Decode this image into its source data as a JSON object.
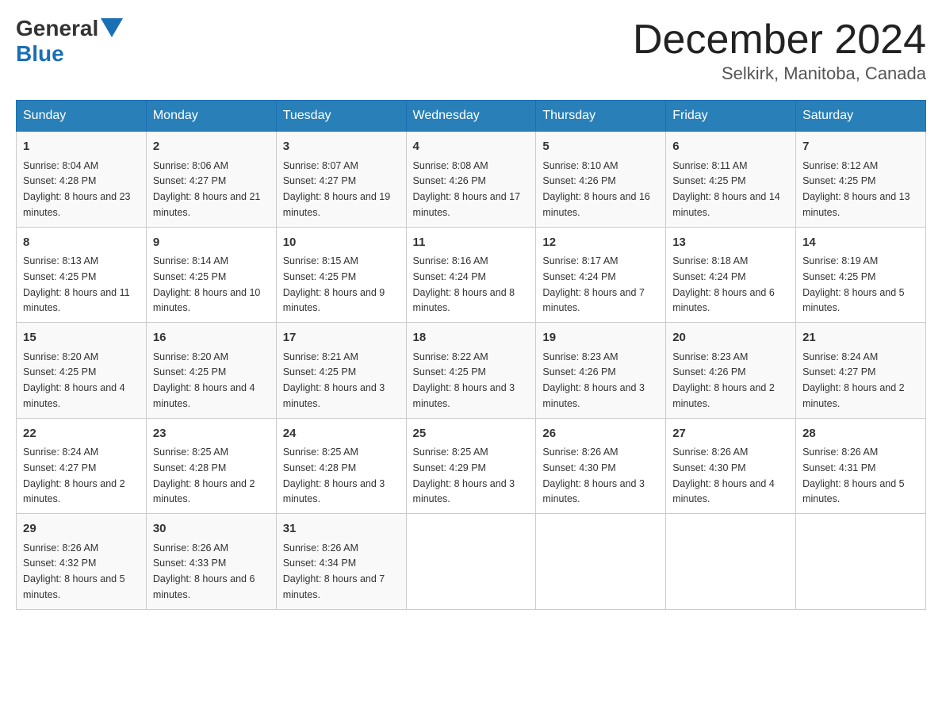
{
  "header": {
    "logo_general": "General",
    "logo_blue": "Blue",
    "month_title": "December 2024",
    "location": "Selkirk, Manitoba, Canada"
  },
  "days_of_week": [
    "Sunday",
    "Monday",
    "Tuesday",
    "Wednesday",
    "Thursday",
    "Friday",
    "Saturday"
  ],
  "weeks": [
    [
      {
        "day": "1",
        "sunrise": "8:04 AM",
        "sunset": "4:28 PM",
        "daylight": "8 hours and 23 minutes."
      },
      {
        "day": "2",
        "sunrise": "8:06 AM",
        "sunset": "4:27 PM",
        "daylight": "8 hours and 21 minutes."
      },
      {
        "day": "3",
        "sunrise": "8:07 AM",
        "sunset": "4:27 PM",
        "daylight": "8 hours and 19 minutes."
      },
      {
        "day": "4",
        "sunrise": "8:08 AM",
        "sunset": "4:26 PM",
        "daylight": "8 hours and 17 minutes."
      },
      {
        "day": "5",
        "sunrise": "8:10 AM",
        "sunset": "4:26 PM",
        "daylight": "8 hours and 16 minutes."
      },
      {
        "day": "6",
        "sunrise": "8:11 AM",
        "sunset": "4:25 PM",
        "daylight": "8 hours and 14 minutes."
      },
      {
        "day": "7",
        "sunrise": "8:12 AM",
        "sunset": "4:25 PM",
        "daylight": "8 hours and 13 minutes."
      }
    ],
    [
      {
        "day": "8",
        "sunrise": "8:13 AM",
        "sunset": "4:25 PM",
        "daylight": "8 hours and 11 minutes."
      },
      {
        "day": "9",
        "sunrise": "8:14 AM",
        "sunset": "4:25 PM",
        "daylight": "8 hours and 10 minutes."
      },
      {
        "day": "10",
        "sunrise": "8:15 AM",
        "sunset": "4:25 PM",
        "daylight": "8 hours and 9 minutes."
      },
      {
        "day": "11",
        "sunrise": "8:16 AM",
        "sunset": "4:24 PM",
        "daylight": "8 hours and 8 minutes."
      },
      {
        "day": "12",
        "sunrise": "8:17 AM",
        "sunset": "4:24 PM",
        "daylight": "8 hours and 7 minutes."
      },
      {
        "day": "13",
        "sunrise": "8:18 AM",
        "sunset": "4:24 PM",
        "daylight": "8 hours and 6 minutes."
      },
      {
        "day": "14",
        "sunrise": "8:19 AM",
        "sunset": "4:25 PM",
        "daylight": "8 hours and 5 minutes."
      }
    ],
    [
      {
        "day": "15",
        "sunrise": "8:20 AM",
        "sunset": "4:25 PM",
        "daylight": "8 hours and 4 minutes."
      },
      {
        "day": "16",
        "sunrise": "8:20 AM",
        "sunset": "4:25 PM",
        "daylight": "8 hours and 4 minutes."
      },
      {
        "day": "17",
        "sunrise": "8:21 AM",
        "sunset": "4:25 PM",
        "daylight": "8 hours and 3 minutes."
      },
      {
        "day": "18",
        "sunrise": "8:22 AM",
        "sunset": "4:25 PM",
        "daylight": "8 hours and 3 minutes."
      },
      {
        "day": "19",
        "sunrise": "8:23 AM",
        "sunset": "4:26 PM",
        "daylight": "8 hours and 3 minutes."
      },
      {
        "day": "20",
        "sunrise": "8:23 AM",
        "sunset": "4:26 PM",
        "daylight": "8 hours and 2 minutes."
      },
      {
        "day": "21",
        "sunrise": "8:24 AM",
        "sunset": "4:27 PM",
        "daylight": "8 hours and 2 minutes."
      }
    ],
    [
      {
        "day": "22",
        "sunrise": "8:24 AM",
        "sunset": "4:27 PM",
        "daylight": "8 hours and 2 minutes."
      },
      {
        "day": "23",
        "sunrise": "8:25 AM",
        "sunset": "4:28 PM",
        "daylight": "8 hours and 2 minutes."
      },
      {
        "day": "24",
        "sunrise": "8:25 AM",
        "sunset": "4:28 PM",
        "daylight": "8 hours and 3 minutes."
      },
      {
        "day": "25",
        "sunrise": "8:25 AM",
        "sunset": "4:29 PM",
        "daylight": "8 hours and 3 minutes."
      },
      {
        "day": "26",
        "sunrise": "8:26 AM",
        "sunset": "4:30 PM",
        "daylight": "8 hours and 3 minutes."
      },
      {
        "day": "27",
        "sunrise": "8:26 AM",
        "sunset": "4:30 PM",
        "daylight": "8 hours and 4 minutes."
      },
      {
        "day": "28",
        "sunrise": "8:26 AM",
        "sunset": "4:31 PM",
        "daylight": "8 hours and 5 minutes."
      }
    ],
    [
      {
        "day": "29",
        "sunrise": "8:26 AM",
        "sunset": "4:32 PM",
        "daylight": "8 hours and 5 minutes."
      },
      {
        "day": "30",
        "sunrise": "8:26 AM",
        "sunset": "4:33 PM",
        "daylight": "8 hours and 6 minutes."
      },
      {
        "day": "31",
        "sunrise": "8:26 AM",
        "sunset": "4:34 PM",
        "daylight": "8 hours and 7 minutes."
      },
      null,
      null,
      null,
      null
    ]
  ]
}
